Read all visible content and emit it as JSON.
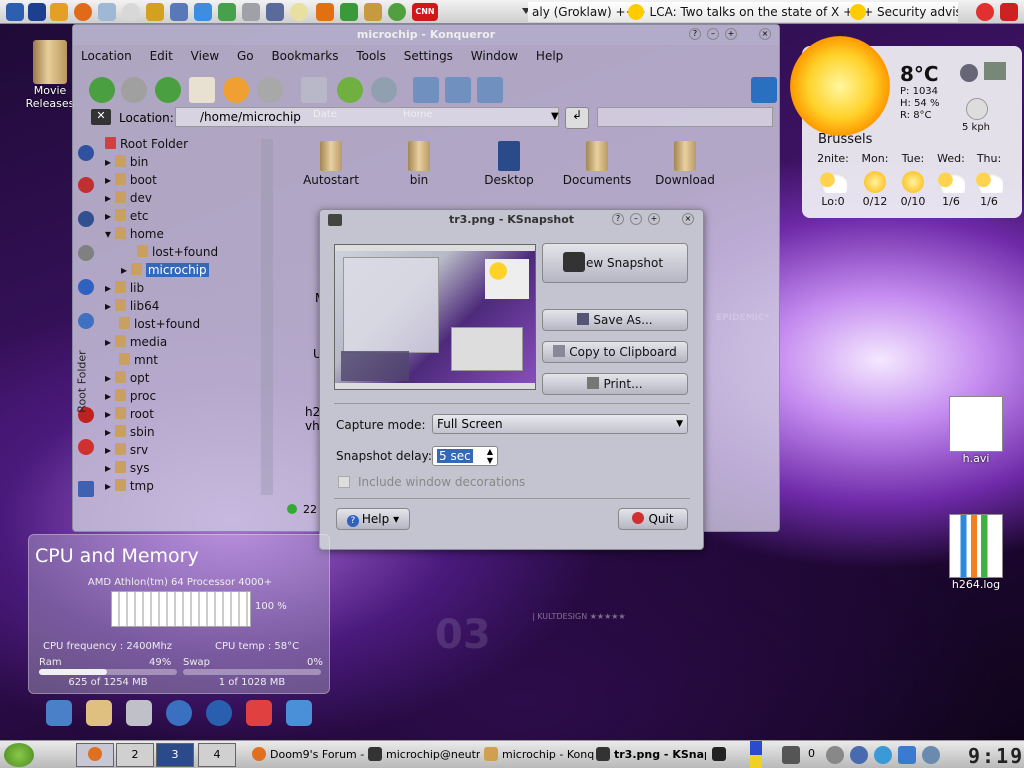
{
  "top_panel": {
    "ticker": "aly (Groklaw) +++ LCA: Two talks on the state of X +++ Security advisori"
  },
  "desktop_icons": {
    "movie_releases": "Movie Releases",
    "h_avi": "h.avi",
    "h264_log": "h264.log"
  },
  "konqueror": {
    "title": "microchip - Konqueror",
    "menu": [
      "Location",
      "Edit",
      "View",
      "Go",
      "Bookmarks",
      "Tools",
      "Settings",
      "Window",
      "Help"
    ],
    "toolbar_labels": [
      "Date",
      "Home"
    ],
    "location_label": "Location:",
    "location_value": "/home/microchip",
    "tree_root": "Root Folder",
    "sidebar_label": "Root Folder",
    "tree": [
      "bin",
      "boot",
      "dev",
      "etc",
      "home",
      "lost+found",
      "microchip",
      "lib",
      "lib64",
      "lost+found",
      "media",
      "mnt",
      "opt",
      "proc",
      "root",
      "sbin",
      "srv",
      "sys",
      "tmp"
    ],
    "files": [
      "Autostart",
      "bin",
      "Desktop",
      "Documents",
      "Download"
    ],
    "partial_files": [
      "M",
      "U",
      "h2",
      "vh"
    ],
    "status": "22"
  },
  "ksnapshot": {
    "title": "tr3.png - KSnapshot",
    "new_snapshot": "New Snapshot",
    "save_as": "Save As...",
    "copy_clipboard": "Copy to Clipboard",
    "print": "Print...",
    "capture_mode_label": "Capture mode:",
    "capture_mode_value": "Full Screen",
    "delay_label": "Snapshot delay:",
    "delay_value": "5 sec",
    "include_decorations": "Include window decorations",
    "help": "Help",
    "quit": "Quit"
  },
  "weather": {
    "temp": "8°C",
    "pressure": "P: 1034",
    "humidity": "H: 54 %",
    "real": "R: 8°C",
    "wind": "5 kph",
    "city": "Brussels",
    "days": [
      {
        "day": "2nite:",
        "temp": "Lo:0"
      },
      {
        "day": "Mon:",
        "temp": "0/12"
      },
      {
        "day": "Tue:",
        "temp": "0/10"
      },
      {
        "day": "Wed:",
        "temp": "1/6"
      },
      {
        "day": "Thu:",
        "temp": "1/6"
      }
    ]
  },
  "cpu": {
    "title": "CPU and Memory",
    "processor": "AMD Athlon(tm) 64 Processor 4000+",
    "cpu_load": "100 %",
    "frequency": "CPU frequency : 2400Mhz",
    "temp": "CPU temp : 58°C",
    "ram_label": "Ram",
    "ram_pct": "49%",
    "ram_fraction": 0.49,
    "ram_used": "625 of 1254 MB",
    "swap_label": "Swap",
    "swap_pct": "0%",
    "swap_fraction": 0.0,
    "swap_used": "1 of 1028 MB"
  },
  "taskbar": {
    "desktops": [
      "2",
      "3",
      "4"
    ],
    "tasks": [
      "Doom9's Forum - S",
      "microchip@neutrin",
      "microchip - Konque",
      "tr3.png - KSnaps"
    ],
    "tray_count": "0",
    "clock": "9:19"
  }
}
